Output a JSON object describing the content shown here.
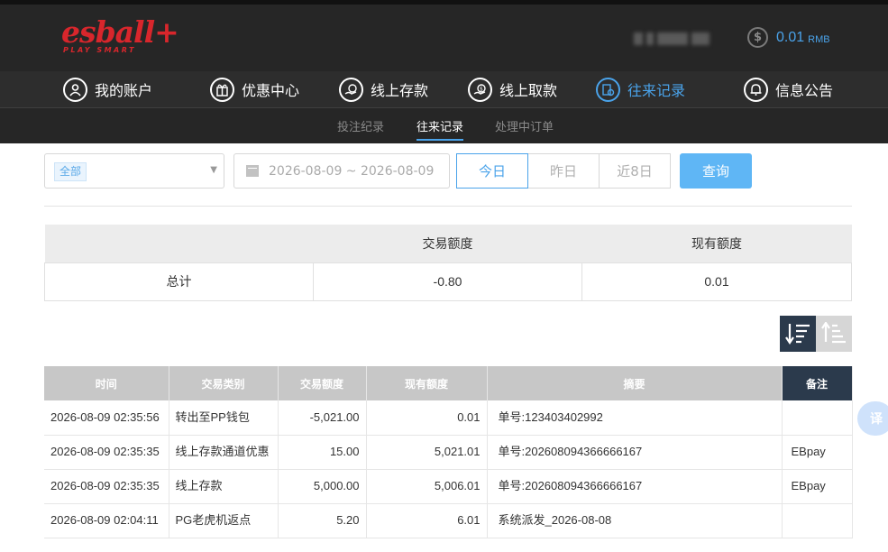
{
  "brand": {
    "logo_text": "esball+",
    "tagline": "PLAY SMART"
  },
  "account": {
    "balance": "0.01",
    "currency": "RMB"
  },
  "main_nav": [
    {
      "label": "我的账户",
      "icon": "user-icon"
    },
    {
      "label": "优惠中心",
      "icon": "gift-icon"
    },
    {
      "label": "线上存款",
      "icon": "deposit-icon"
    },
    {
      "label": "线上取款",
      "icon": "withdraw-icon"
    },
    {
      "label": "往来记录",
      "icon": "records-icon",
      "active": true
    },
    {
      "label": "信息公告",
      "icon": "bell-icon"
    }
  ],
  "sub_nav": [
    {
      "label": "投注纪录"
    },
    {
      "label": "往来记录",
      "active": true
    },
    {
      "label": "处理中订单"
    }
  ],
  "filter": {
    "type_tag": "全部",
    "date_range": "2026-08-09 ~ 2026-08-09",
    "quick_ranges": [
      "今日",
      "昨日",
      "近8日"
    ],
    "active_quick": "今日",
    "query_label": "查询"
  },
  "summary": {
    "headers": [
      "",
      "交易额度",
      "现有额度"
    ],
    "row": [
      "总计",
      "-0.80",
      "0.01"
    ]
  },
  "records": {
    "headers": [
      "时间",
      "交易类别",
      "交易额度",
      "现有额度",
      "摘要",
      "备注"
    ],
    "rows": [
      [
        "2026-08-09 02:35:56",
        "转出至PP钱包",
        "-5,021.00",
        "0.01",
        "单号:123403402992",
        ""
      ],
      [
        "2026-08-09 02:35:35",
        "线上存款通道优惠",
        "15.00",
        "5,021.01",
        "单号:202608094366666167",
        "EBpay"
      ],
      [
        "2026-08-09 02:35:35",
        "线上存款",
        "5,000.00",
        "5,006.01",
        "单号:202608094366666167",
        "EBpay"
      ],
      [
        "2026-08-09 02:04:11",
        "PG老虎机返点",
        "5.20",
        "6.01",
        "系统派发_2026-08-08",
        ""
      ]
    ]
  },
  "translate_label": "译",
  "colors": {
    "accent": "#4aa3ea",
    "brand_red": "#d8262c",
    "header_bg": "#262626"
  }
}
